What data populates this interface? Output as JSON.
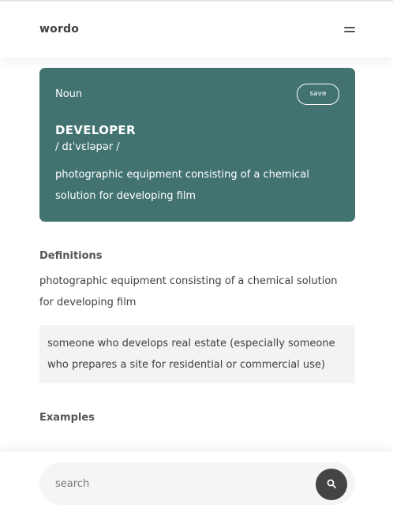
{
  "app": {
    "brand": "wordo"
  },
  "word_card": {
    "part_of_speech": "Noun",
    "save_label": "save",
    "word": "DEVELOPER",
    "pronunciation": "/ dɪˈvɛləpər /",
    "definition": "photographic equipment consisting of a chemical solution for developing film"
  },
  "definitions": {
    "title": "Definitions",
    "items": [
      "photographic equipment consisting of a chemical solution for developing film",
      "someone who develops real estate (especially someone who prepares a site for residential or commercial use)"
    ]
  },
  "examples": {
    "title": "Examples"
  },
  "search": {
    "placeholder": "search"
  },
  "colors": {
    "card_background": "#427371",
    "definition_highlight": "#f3f3f3",
    "search_button": "#444444"
  }
}
